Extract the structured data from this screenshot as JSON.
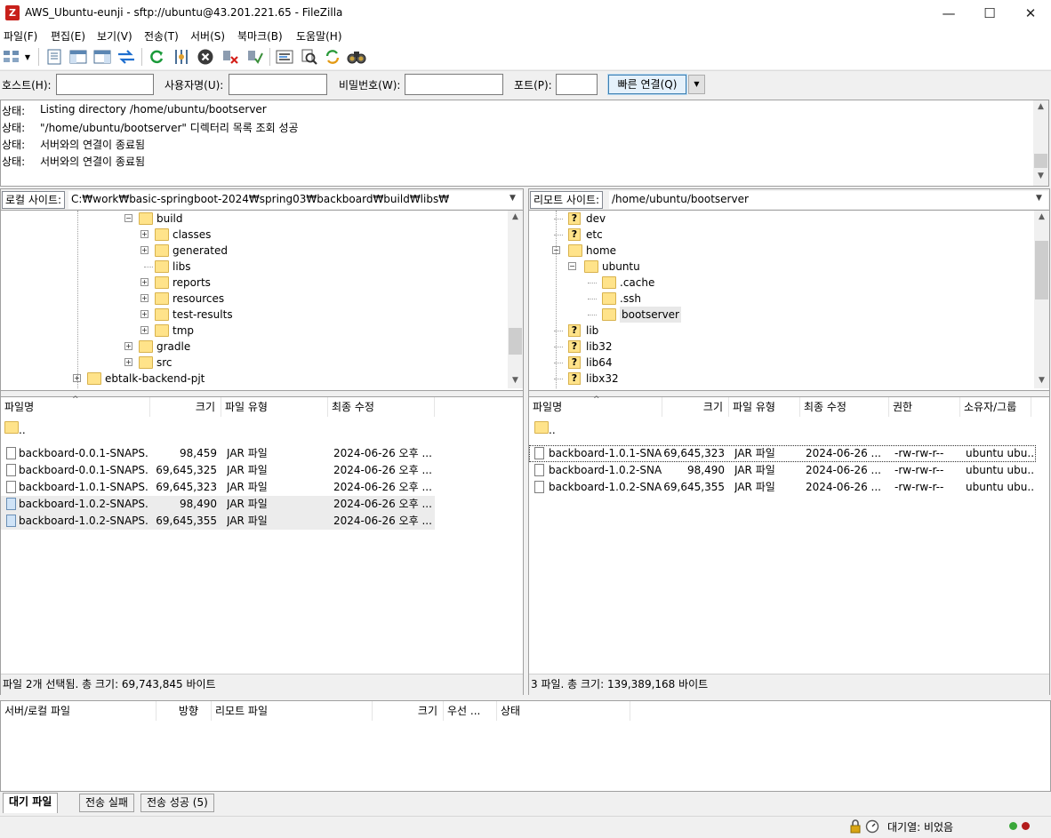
{
  "window": {
    "title": "AWS_Ubuntu-eunji - sftp://ubuntu@43.201.221.65 - FileZilla",
    "minimize": "—",
    "maximize": "☐",
    "close": "✕"
  },
  "menu": [
    "파일(F)",
    "편집(E)",
    "보기(V)",
    "전송(T)",
    "서버(S)",
    "북마크(B)",
    "도움말(H)"
  ],
  "toolbar": [
    "site-manager-icon",
    "dropdown-icon",
    "toggle-log-icon",
    "toggle-local-tree-icon",
    "toggle-remote-tree-icon",
    "toggle-queue-icon",
    "refresh-icon",
    "process-queue-icon",
    "cancel-icon",
    "disconnect-icon",
    "reconnect-icon",
    "filter-icon",
    "compare-icon",
    "sync-browse-icon",
    "search-icon"
  ],
  "quickconnect": {
    "host_label": "호스트(H):",
    "user_label": "사용자명(U):",
    "pass_label": "비밀번호(W):",
    "port_label": "포트(P):",
    "host": "",
    "user": "",
    "pass": "",
    "port": "",
    "connect_label": "빠른 연결(Q)"
  },
  "log": [
    {
      "label": "상태:",
      "text": "Listing directory /home/ubuntu/bootserver"
    },
    {
      "label": "상태:",
      "text": "\"/home/ubuntu/bootserver\" 디렉터리 목록 조회 성공"
    },
    {
      "label": "상태:",
      "text": "서버와의 연결이 종료됨"
    },
    {
      "label": "상태:",
      "text": "서버와의 연결이 종료됨"
    }
  ],
  "local": {
    "site_label": "로컬 사이트:",
    "path": "C:₩work₩basic-springboot-2024₩spring03₩backboard₩build₩libs₩",
    "tree": [
      {
        "name": "build",
        "exp": "−"
      },
      {
        "name": "classes",
        "exp": "+"
      },
      {
        "name": "generated",
        "exp": "+"
      },
      {
        "name": "libs",
        "exp": ""
      },
      {
        "name": "reports",
        "exp": "+"
      },
      {
        "name": "resources",
        "exp": "+"
      },
      {
        "name": "test-results",
        "exp": "+"
      },
      {
        "name": "tmp",
        "exp": "+"
      },
      {
        "name": "gradle",
        "exp": "+"
      },
      {
        "name": "src",
        "exp": "+"
      },
      {
        "name": "ebtalk-backend-pjt",
        "exp": "+"
      }
    ],
    "headers": [
      "파일명",
      "크기",
      "파일 유형",
      "최종 수정"
    ],
    "parent": "..",
    "files": [
      {
        "name": "backboard-0.0.1-SNAPS...",
        "size": "98,459",
        "type": "JAR 파일",
        "modified": "2024-06-26 오후 ...",
        "selected": false
      },
      {
        "name": "backboard-0.0.1-SNAPS...",
        "size": "69,645,325",
        "type": "JAR 파일",
        "modified": "2024-06-26 오후 ...",
        "selected": false
      },
      {
        "name": "backboard-1.0.1-SNAPS...",
        "size": "69,645,323",
        "type": "JAR 파일",
        "modified": "2024-06-26 오후 ...",
        "selected": false
      },
      {
        "name": "backboard-1.0.2-SNAPS...",
        "size": "98,490",
        "type": "JAR 파일",
        "modified": "2024-06-26 오후 ...",
        "selected": true
      },
      {
        "name": "backboard-1.0.2-SNAPS...",
        "size": "69,645,355",
        "type": "JAR 파일",
        "modified": "2024-06-26 오후 ...",
        "selected": true
      }
    ],
    "status": "파일 2개 선택됨. 총 크기: 69,743,845 바이트"
  },
  "remote": {
    "site_label": "리모트 사이트:",
    "path": "/home/ubuntu/bootserver",
    "tree": [
      {
        "name": "dev",
        "kind": "q"
      },
      {
        "name": "etc",
        "kind": "q"
      },
      {
        "name": "home",
        "kind": "f",
        "exp": "−"
      },
      {
        "name": "ubuntu",
        "kind": "f",
        "exp": "−"
      },
      {
        "name": ".cache",
        "kind": "f"
      },
      {
        "name": ".ssh",
        "kind": "f"
      },
      {
        "name": "bootserver",
        "kind": "f"
      },
      {
        "name": "lib",
        "kind": "q"
      },
      {
        "name": "lib32",
        "kind": "q"
      },
      {
        "name": "lib64",
        "kind": "q"
      },
      {
        "name": "libx32",
        "kind": "q"
      }
    ],
    "headers": [
      "파일명",
      "크기",
      "파일 유형",
      "최종 수정",
      "권한",
      "소유자/그룹"
    ],
    "parent": "..",
    "files": [
      {
        "name": "backboard-1.0.1-SNA...",
        "size": "69,645,323",
        "type": "JAR 파일",
        "modified": "2024-06-26 ...",
        "perm": "-rw-rw-r--",
        "owner": "ubuntu ubu..."
      },
      {
        "name": "backboard-1.0.2-SNA...",
        "size": "98,490",
        "type": "JAR 파일",
        "modified": "2024-06-26 ...",
        "perm": "-rw-rw-r--",
        "owner": "ubuntu ubu..."
      },
      {
        "name": "backboard-1.0.2-SNA...",
        "size": "69,645,355",
        "type": "JAR 파일",
        "modified": "2024-06-26 ...",
        "perm": "-rw-rw-r--",
        "owner": "ubuntu ubu..."
      }
    ],
    "status": "3 파일. 총 크기: 139,389,168 바이트"
  },
  "queue": {
    "headers": [
      "서버/로컬 파일",
      "방향",
      "리모트 파일",
      "크기",
      "우선 ...",
      "상태"
    ],
    "tabs": [
      "대기 파일",
      "전송 실패",
      "전송 성공 (5)"
    ]
  },
  "statusbar": {
    "queue_text": "대기열: 비었음"
  }
}
